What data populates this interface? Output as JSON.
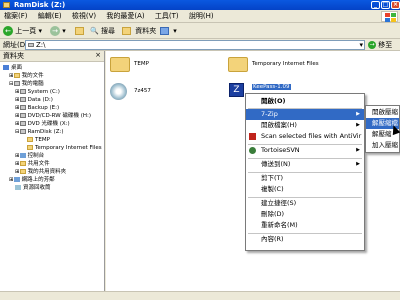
{
  "window": {
    "title": "RamDisk (Z:)"
  },
  "menubar": [
    "檔案(F)",
    "編輯(E)",
    "檢視(V)",
    "我的最愛(A)",
    "工具(T)",
    "說明(H)"
  ],
  "toolbar": {
    "back": "上一頁",
    "search": "搜尋",
    "folders": "資料夾"
  },
  "address": {
    "label": "網址(D)",
    "value": "Z:\\",
    "go": "移至"
  },
  "sidebar": {
    "title": "資料夾",
    "tree": [
      "桌面",
      "我的文件",
      "我的電腦",
      "System (C:)",
      "Data (D:)",
      "Backup (E:)",
      "DVD/CD-RW 磁碟機 (H:)",
      "DVD 光碟機 (X:)",
      "RamDisk (Z:)",
      "TEMP",
      "Temporary Internet Files",
      "控制台",
      "共用文件",
      "我的共用資料夾",
      "網路上的芳鄰",
      "資源回收筒"
    ]
  },
  "files": [
    {
      "name": "TEMP"
    },
    {
      "name": "Temporary Internet Files"
    },
    {
      "name": "7z457"
    },
    {
      "name": "KeePass-1.09"
    }
  ],
  "context_menu": {
    "items": [
      "開啟(O)",
      "7-Zip",
      "開啟檔案(H)",
      "Scan selected files with AntiVir",
      "TortoiseSVN",
      "傳送到(N)",
      "剪下(T)",
      "複製(C)",
      "建立捷徑(S)",
      "刪除(D)",
      "重新命名(M)",
      "內容(R)"
    ]
  },
  "submenu": {
    "items": [
      "開啟壓縮",
      "解壓縮檔",
      "解壓縮",
      "加入壓縮"
    ]
  },
  "colors": {
    "selection": "#316ac5",
    "titlebar": "#0a58e0",
    "folder": "#f3d37a"
  }
}
